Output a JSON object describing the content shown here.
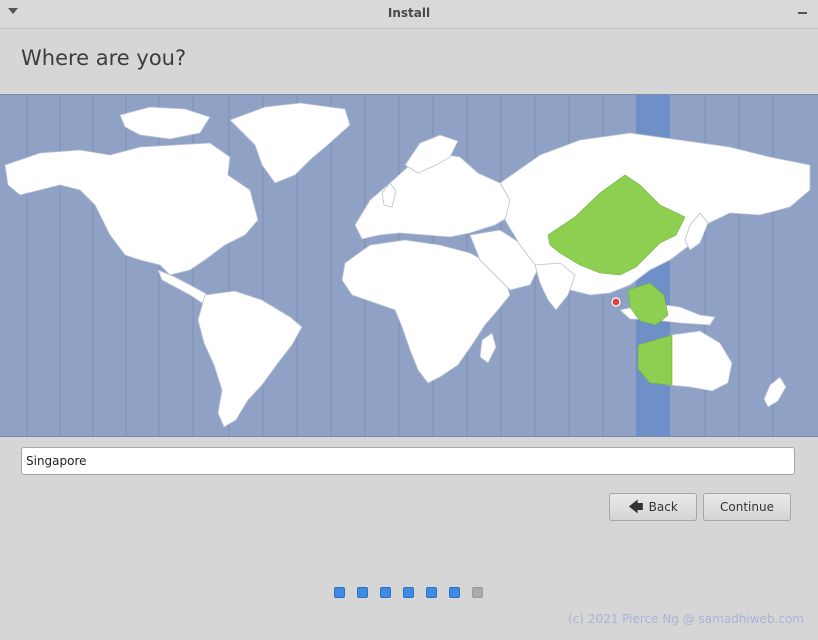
{
  "window": {
    "title": "Install"
  },
  "page": {
    "heading": "Where are you?"
  },
  "location": {
    "value": "Singapore"
  },
  "buttons": {
    "back_label": "Back",
    "continue_label": "Continue"
  },
  "progress": {
    "total_steps": 7,
    "completed_steps": 6
  },
  "map": {
    "selected_zone_color": "#8ccf51",
    "ocean_color": "#8fa2c6",
    "land_color": "#ffffff",
    "pin_color": "#e04040"
  },
  "watermark": "(c) 2021 Pierce Ng @ samadhiweb.com"
}
